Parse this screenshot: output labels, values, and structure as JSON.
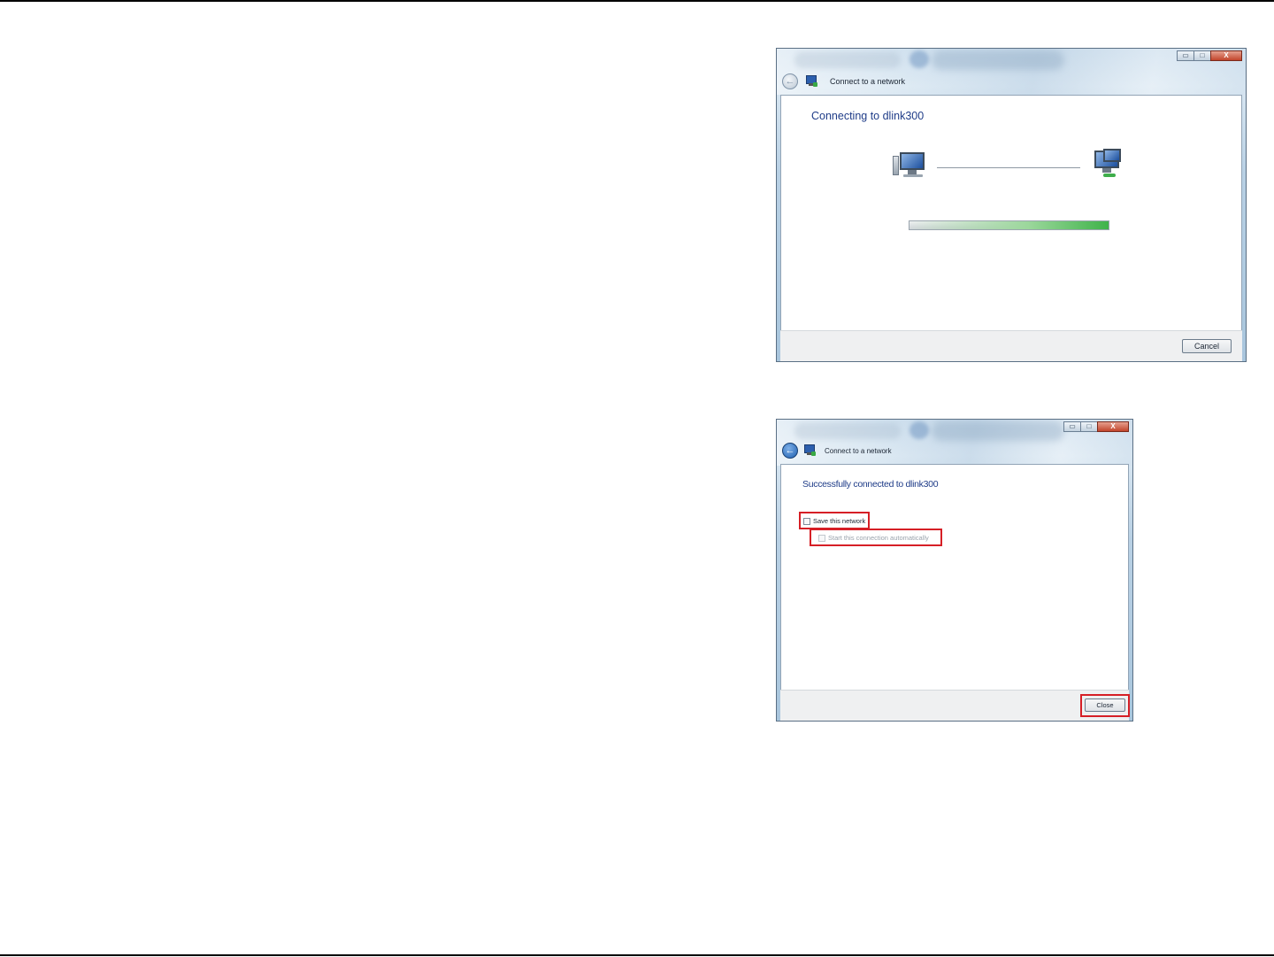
{
  "window1": {
    "nav_title": "Connect to a network",
    "heading": "Connecting to dlink300",
    "progress_fraction": 1.0,
    "cancel_label": "Cancel",
    "caption_buttons": {
      "minimize": "▭",
      "maximize": "□",
      "close": "X"
    }
  },
  "window2": {
    "nav_title": "Connect to a network",
    "heading": "Successfully connected to dlink300",
    "checkbox_save_label": "Save this network",
    "checkbox_save_checked": false,
    "checkbox_auto_label": "Start this connection automatically",
    "checkbox_auto_checked": false,
    "close_label": "Close",
    "caption_buttons": {
      "minimize": "▭",
      "maximize": "□",
      "close": "X"
    },
    "highlight_color": "#d61f26"
  },
  "colors": {
    "heading": "#1f3c88",
    "progress": "#3fb34a"
  },
  "icons": [
    "back-arrow-icon",
    "network-icon",
    "computer-icon",
    "network-computers-icon"
  ]
}
